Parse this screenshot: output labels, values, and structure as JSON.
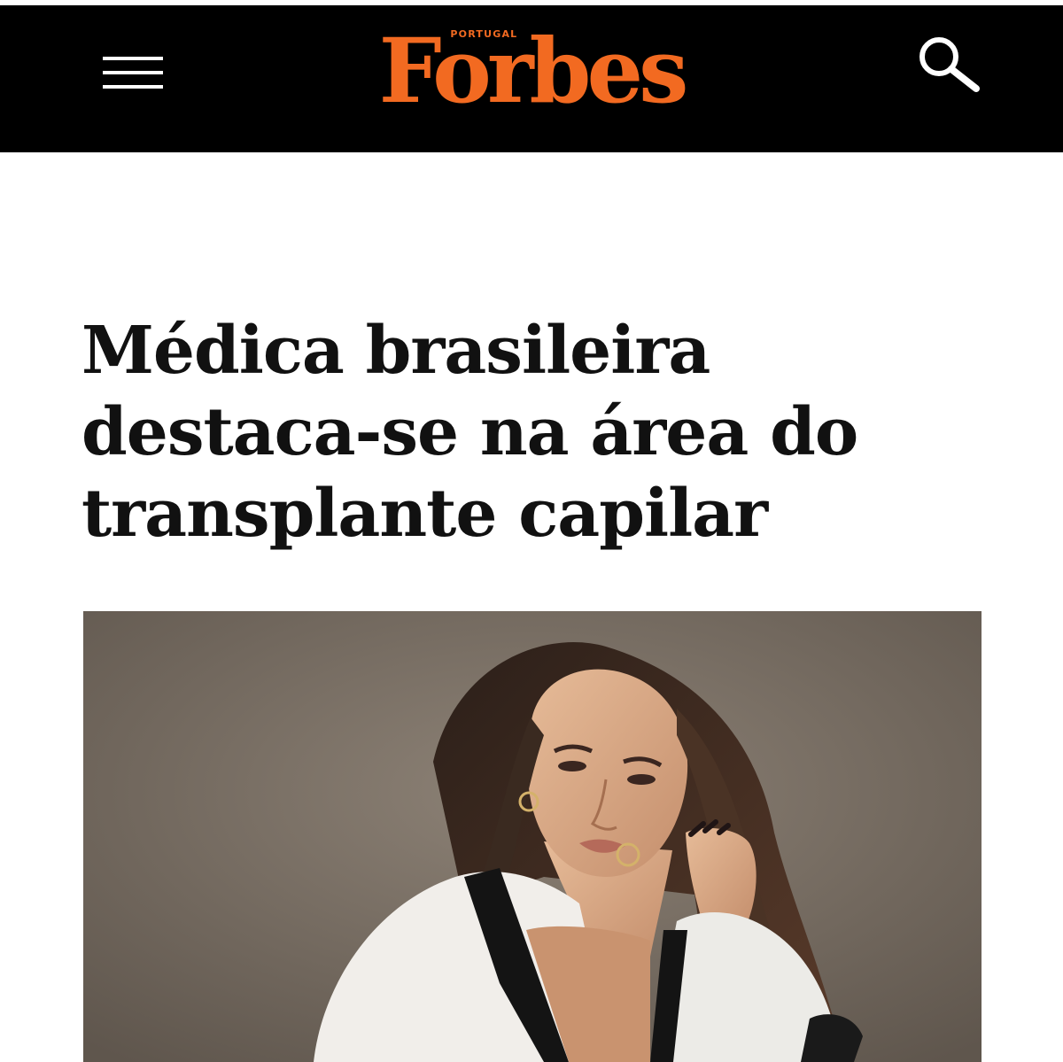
{
  "header": {
    "menu_icon": "hamburger-menu-icon",
    "logo": {
      "brand": "Forbes",
      "edition": "PORTUGAL",
      "color": "#f26a21"
    },
    "search_icon": "search-icon",
    "background": "#000000"
  },
  "article": {
    "headline": "Médica brasileira destaca-se na área do transplante capilar",
    "hero_image": "portrait-photo"
  }
}
